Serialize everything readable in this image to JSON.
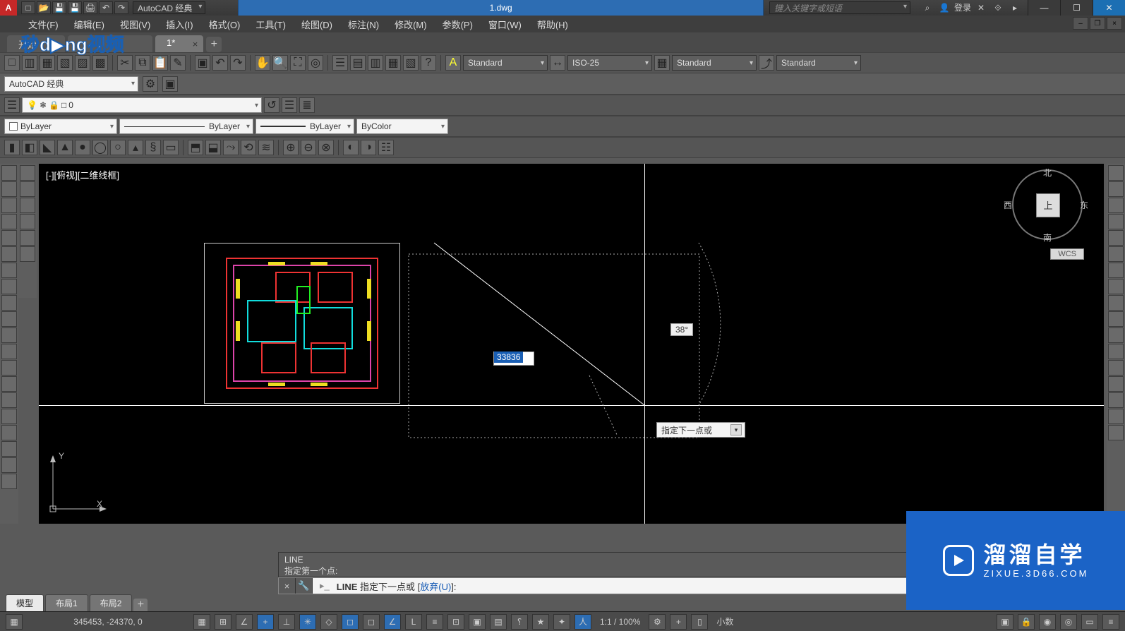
{
  "titlebar": {
    "logo": "A",
    "workspace_dd": "AutoCAD 经典",
    "filename": "1.dwg",
    "search_placeholder": "键入关键字或短语",
    "login": "登录"
  },
  "menu": [
    "文件(F)",
    "编辑(E)",
    "视图(V)",
    "插入(I)",
    "格式(O)",
    "工具(T)",
    "绘图(D)",
    "标注(N)",
    "修改(M)",
    "参数(P)",
    "窗口(W)",
    "帮助(H)"
  ],
  "filetabs": {
    "start": "开始",
    "doc": "1*"
  },
  "styles": {
    "text": "Standard",
    "dim": "ISO-25",
    "table": "Standard",
    "mleader": "Standard"
  },
  "workspace_combo": "AutoCAD 经典",
  "layer": {
    "current": "0"
  },
  "props": {
    "color": "ByLayer",
    "ltype": "ByLayer",
    "lweight": "ByLayer",
    "plotstyle": "ByColor"
  },
  "viewport": {
    "label": "[-][俯视][二维线框]"
  },
  "viewcube": {
    "n": "北",
    "s": "南",
    "e": "东",
    "w": "西",
    "top": "上",
    "wcs": "WCS"
  },
  "dynamic": {
    "length": "33836",
    "angle": "38°",
    "prompt": "指定下一点或"
  },
  "ucs": {
    "x": "X",
    "y": "Y"
  },
  "cmd": {
    "hist1": "LINE",
    "hist2": "指定第一个点:",
    "name": "LINE",
    "prompt": "指定下一点或 [",
    "undo": "放弃(U)",
    "suffix": "]:"
  },
  "layouts": {
    "model": "模型",
    "l1": "布局1",
    "l2": "布局2"
  },
  "status": {
    "coord": "345453, -24370, 0",
    "scale": "1:1 / 100%",
    "units": "小数"
  },
  "watermark_top": "秒dong视频",
  "watermark_br": {
    "big": "溜溜自学",
    "sm": "ZIXUE.3D66.COM"
  }
}
